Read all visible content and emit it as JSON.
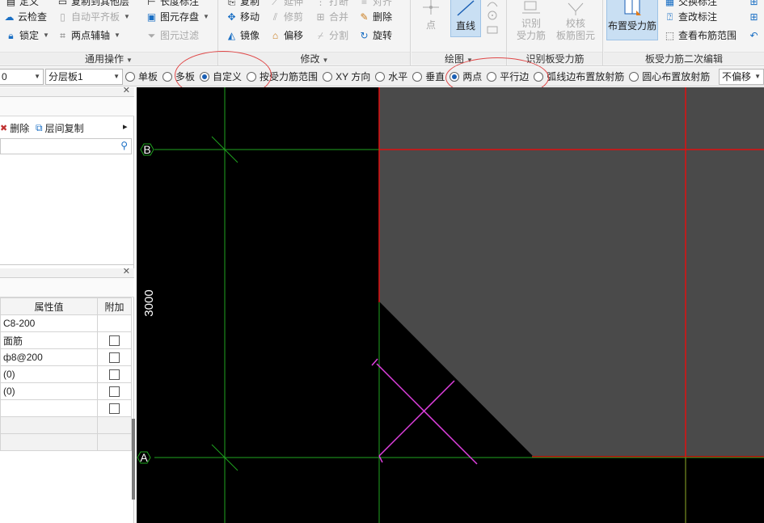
{
  "ribbon": {
    "groups": {
      "common": {
        "title": "通用操作",
        "items": {
          "define": "定义",
          "copy_to_floor": "复制到其他层",
          "length_dim": "长度标注",
          "cloud_check": "云检查",
          "auto_align": "自动平齐板",
          "element_save": "图元存盘",
          "lock": "锁定",
          "two_point_axis": "两点辅轴",
          "element_filter": "图元过滤"
        }
      },
      "modify": {
        "title": "修改",
        "items": {
          "copy": "复制",
          "extend": "延伸",
          "break": "打断",
          "align": "对齐",
          "move": "移动",
          "trim": "修剪",
          "merge": "合并",
          "delete": "删除",
          "mirror": "镜像",
          "offset": "偏移",
          "split": "分割",
          "rotate": "旋转"
        }
      },
      "draw": {
        "title": "绘图",
        "point": "点",
        "line": "直线"
      },
      "identify": {
        "title": "识别板受力筋",
        "identify_rebar": "识别\n受力筋",
        "check_rebar": "校核\n板筋图元"
      },
      "edit2": {
        "title": "板受力筋二次编辑",
        "place_rebar": "布置受力筋",
        "swap_label": "交换标注",
        "check_label": "查改标注",
        "view_range": "查看布筋范围"
      }
    }
  },
  "optbar": {
    "combo1_value": "0",
    "combo2_value": "分层板1",
    "options": [
      {
        "label": "单板",
        "checked": false
      },
      {
        "label": "多板",
        "checked": false
      },
      {
        "label": "自定义",
        "checked": true
      },
      {
        "label": "按受力筋范围",
        "checked": false
      },
      {
        "label": "XY 方向",
        "checked": false
      },
      {
        "label": "水平",
        "checked": false
      },
      {
        "label": "垂直",
        "checked": false
      },
      {
        "label": "两点",
        "checked": true
      },
      {
        "label": "平行边",
        "checked": false
      },
      {
        "label": "弧线边布置放射筋",
        "checked": false
      },
      {
        "label": "圆心布置放射筋",
        "checked": false
      }
    ],
    "offset_value": "不偏移"
  },
  "leftpanel": {
    "delete_label": "删除",
    "floor_copy_label": "层间复制",
    "more_arrow": "▸",
    "props": {
      "header_value": "属性值",
      "header_add": "附加",
      "rows": [
        {
          "value": "C8-200",
          "check": false
        },
        {
          "value": "面筋",
          "check": true
        },
        {
          "value": "ф8@200",
          "check": true
        },
        {
          "value": "(0)",
          "check": true
        },
        {
          "value": "(0)",
          "check": true
        },
        {
          "value": "",
          "check": true
        },
        {
          "value": "",
          "check": false
        },
        {
          "value": "",
          "check": false
        }
      ]
    }
  },
  "canvas": {
    "axis_b": "B",
    "axis_a": "A",
    "dimension": "3000",
    "colors": {
      "background": "#000000",
      "slab": "#4a4a4a",
      "axis": "#1fa31f",
      "boundary": "#e01010",
      "rebar": "#e040e0",
      "edge": "#000000"
    }
  }
}
